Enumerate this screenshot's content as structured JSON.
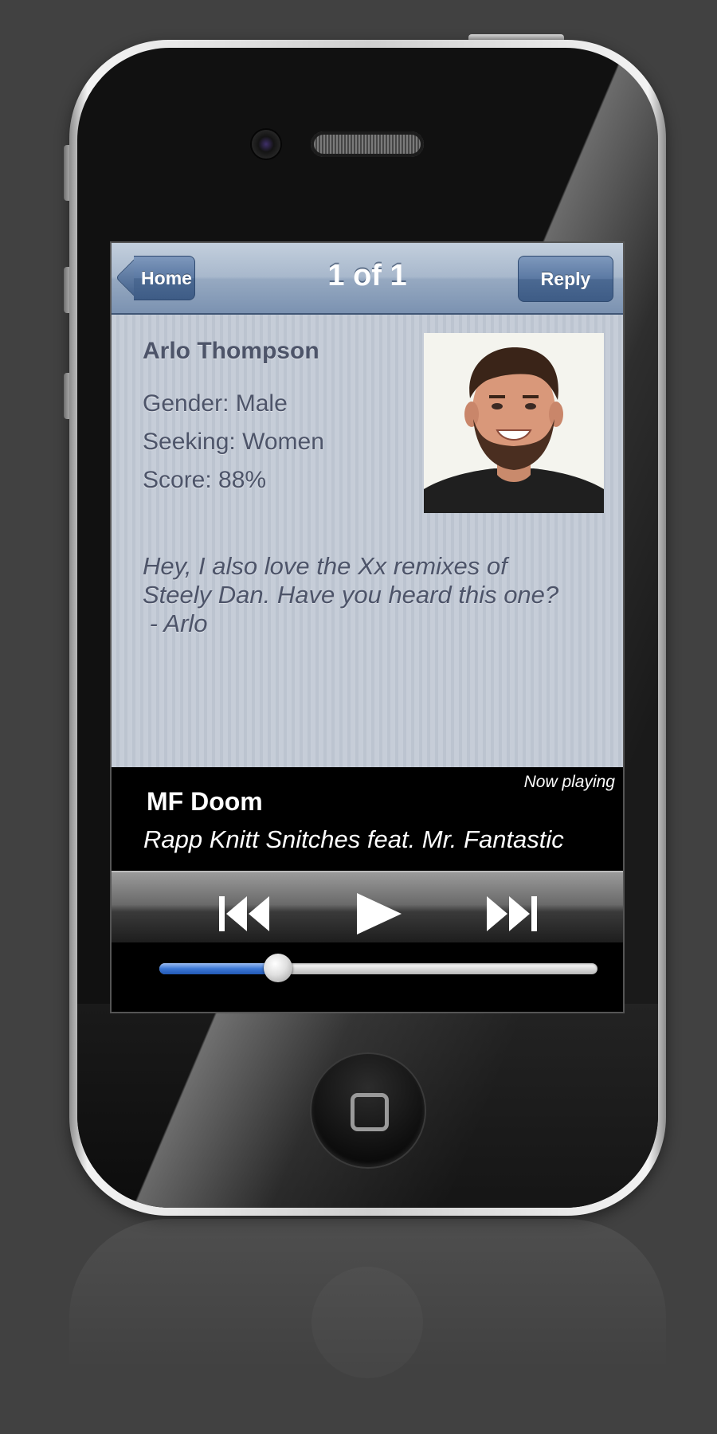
{
  "navbar": {
    "title": "1 of 1",
    "back_label": "Home",
    "reply_label": "Reply"
  },
  "profile": {
    "name": "Arlo Thompson",
    "gender": "Gender: Male",
    "seeking": "Seeking: Women",
    "score": "Score: 88%",
    "message": "Hey, I also love the Xx remixes of\nSteely Dan. Have you heard this one?\n - Arlo"
  },
  "player": {
    "label": "Now playing",
    "artist": "MF Doom",
    "track": "Rapp Knitt Snitches feat. Mr. Fantastic",
    "progress": 0.27
  },
  "colors": {
    "accent": "#3c78d6",
    "nav": "#7b92b1",
    "text": "#4d5469"
  },
  "icons": {
    "previous": "skip-back-icon",
    "play": "play-icon",
    "next": "skip-forward-icon",
    "home": "home-button-square-icon"
  }
}
